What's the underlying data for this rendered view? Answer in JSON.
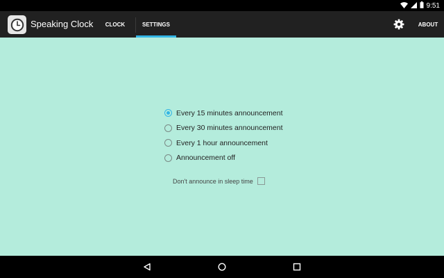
{
  "status_bar": {
    "time": "9:51",
    "icons": [
      "wifi-icon",
      "signal-icon",
      "battery-icon"
    ]
  },
  "app_bar": {
    "title": "Speaking Clock",
    "icon": "clock-icon",
    "tabs": [
      {
        "label": "CLOCK",
        "selected": false
      },
      {
        "label": "SETTINGS",
        "selected": true
      }
    ],
    "settings_icon": "gear-icon",
    "about_label": "ABOUT"
  },
  "settings": {
    "announcement_options": [
      {
        "label": "Every 15 minutes announcement",
        "checked": true
      },
      {
        "label": "Every 30 minutes announcement",
        "checked": false
      },
      {
        "label": "Every 1 hour announcement",
        "checked": false
      },
      {
        "label": "Announcement off",
        "checked": false
      }
    ],
    "sleep_time_label": "Don't announce in sleep time",
    "sleep_time_checked": false
  },
  "nav_bar": {
    "buttons": [
      "back-icon",
      "home-icon",
      "recents-icon"
    ]
  },
  "colors": {
    "accent": "#33b5e5",
    "background": "#b4ecdc",
    "app_bar": "#212121"
  }
}
